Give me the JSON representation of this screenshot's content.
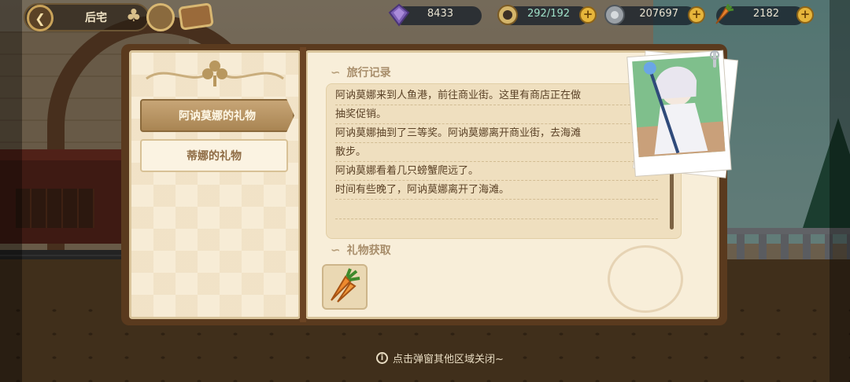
{
  "hud": {
    "location_title": "后宅",
    "gems": "8433",
    "stamina": "292/192",
    "coins": "207697",
    "carrots": "2182"
  },
  "colors": {
    "tab_active_bg": "#b8935f",
    "panel_bg": "#f8eed9",
    "text_brown": "#5b4227",
    "accent_gold": "#e6b53b"
  },
  "tabs": [
    {
      "label": "阿讷莫娜的礼物",
      "active": true
    },
    {
      "label": "蒂娜的礼物",
      "active": false
    }
  ],
  "travel_log": {
    "heading": "旅行记录",
    "lines": [
      "阿讷莫娜来到人鱼港，前往商业街。这里有商店正在做",
      "抽奖促销。",
      "阿讷莫娜抽到了三等奖。阿讷莫娜离开商业街，去海滩",
      "散步。",
      "阿讷莫娜看着几只螃蟹爬远了。",
      "时间有些晚了，阿讷莫娜离开了海滩。"
    ]
  },
  "gift_section": {
    "heading": "礼物获取",
    "items": [
      {
        "icon": "carrot-icon"
      }
    ]
  },
  "hint": "点击弹窗其他区域关闭~",
  "icons": {
    "back": "back-arrow-icon",
    "gem": "gem-icon",
    "stamina": "stamina-icon",
    "coin": "coin-icon",
    "carrot": "carrot-icon",
    "add": "plus-icon",
    "info": "info-icon"
  }
}
